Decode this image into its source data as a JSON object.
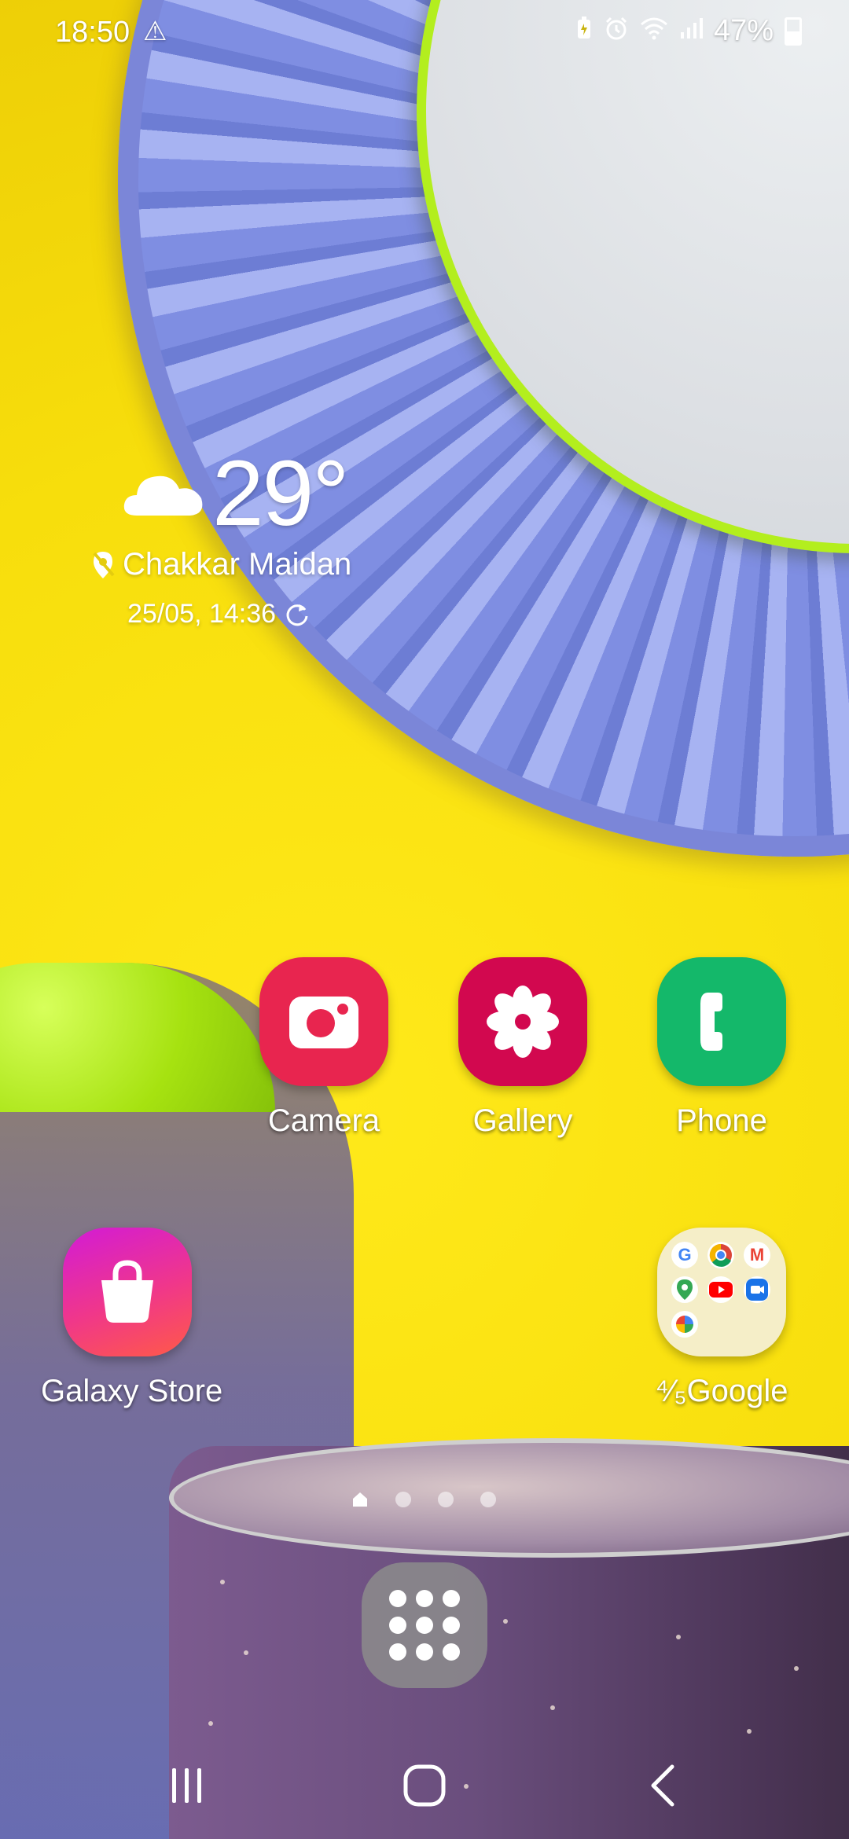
{
  "status_bar": {
    "time": "18:50",
    "warning_icon": "warning-triangle-icon",
    "battery": "47%",
    "battery_level": 0.47,
    "icons": [
      "battery-saver-icon",
      "alarm-icon",
      "wifi-icon",
      "signal-icon"
    ]
  },
  "weather": {
    "temperature": "29°",
    "location": "Chakkar Maidan",
    "updated": "25/05, 14:36",
    "condition_icon": "cloud-icon"
  },
  "apps": {
    "camera": "Camera",
    "gallery": "Gallery",
    "phone": "Phone",
    "galaxy_store": "Galaxy Store",
    "google_folder": "⁴⁄₅Google"
  },
  "page_indicator": {
    "pages": 4,
    "current": 1
  },
  "colors": {
    "camera": "#e8254f",
    "gallery": "#d2084f",
    "phone": "#14b86a",
    "store_from": "#d21bd6",
    "store_to": "#ff5a47",
    "wallpaper_yellow": "#f6e10f"
  }
}
